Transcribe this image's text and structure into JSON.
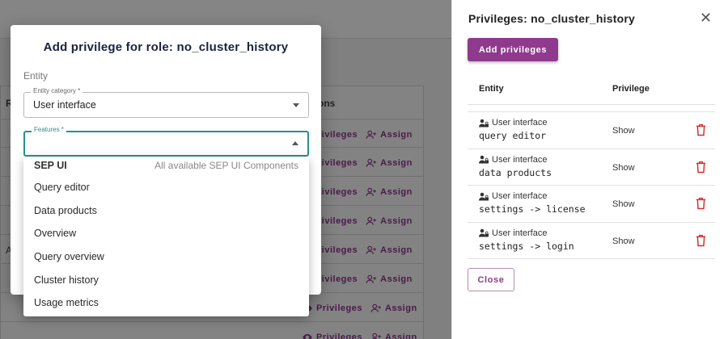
{
  "background": {
    "column_actions": "ons",
    "row_letter_header": "R",
    "row_letter_a": "A",
    "row_actions": [
      {
        "privileges": "rivileges",
        "assign": "Assign"
      },
      {
        "privileges": "rivileges",
        "assign": "Assign"
      },
      {
        "privileges": "rivileges",
        "assign": "Assign"
      },
      {
        "privileges": "rivileges",
        "assign": "Assign"
      },
      {
        "privileges": "rivileges",
        "assign": "Assign"
      },
      {
        "privileges": "rivileges",
        "assign": "Assign"
      },
      {
        "privileges": "Privileges",
        "assign": "Assign"
      },
      {
        "privileges": "Privileges",
        "assign": "Assign"
      }
    ]
  },
  "modal": {
    "title": "Add privilege for role: no_cluster_history",
    "section": "Entity",
    "entity_category": {
      "label": "Entity category *",
      "value": "User interface"
    },
    "features": {
      "label": "Features *",
      "value": ""
    },
    "dropdown": {
      "group": {
        "name": "SEP UI",
        "description": "All available SEP UI Components"
      },
      "options": [
        "Query editor",
        "Data products",
        "Overview",
        "Query overview",
        "Cluster history",
        "Usage metrics"
      ]
    }
  },
  "drawer": {
    "title": "Privileges: no_cluster_history",
    "close_icon": "close-icon",
    "add_button": "Add privileges",
    "columns": {
      "entity": "Entity",
      "privilege": "Privilege"
    },
    "rows": [
      {
        "type": "User interface",
        "name": "query editor",
        "privilege": "Show"
      },
      {
        "type": "User interface",
        "name": "data products",
        "privilege": "Show"
      },
      {
        "type": "User interface",
        "name": "settings -> license",
        "privilege": "Show"
      },
      {
        "type": "User interface",
        "name": "settings -> login",
        "privilege": "Show"
      }
    ],
    "close_button": "Close"
  },
  "colors": {
    "accent": "#8f3a8c",
    "focus": "#2b8f8f",
    "danger": "#d32f2f",
    "title": "#1b2240"
  }
}
